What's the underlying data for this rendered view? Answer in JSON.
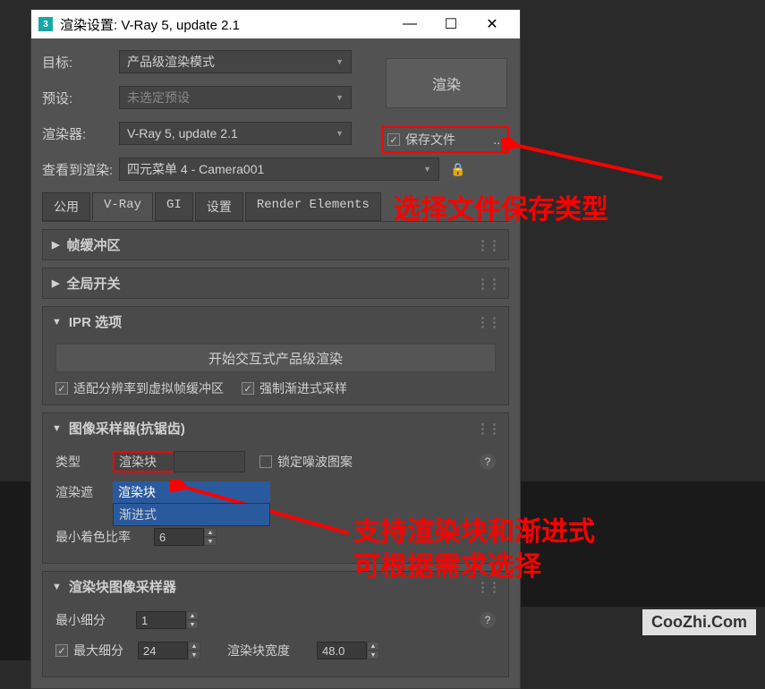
{
  "window": {
    "title": "渲染设置: V-Ray 5, update 2.1"
  },
  "form": {
    "target_label": "目标:",
    "target_value": "产品级渲染模式",
    "preset_label": "预设:",
    "preset_value": "未选定预设",
    "renderer_label": "渲染器:",
    "renderer_value": "V-Ray 5, update 2.1",
    "view_label": "查看到渲染:",
    "view_value": "四元菜单 4 - Camera001"
  },
  "render_button": "渲染",
  "save": {
    "label": "保存文件",
    "dots": "..."
  },
  "tabs": {
    "common": "公用",
    "vray": "V-Ray",
    "gi": "GI",
    "settings": "设置",
    "elements": "Render Elements"
  },
  "rollouts": {
    "fb": "帧缓冲区",
    "global": "全局开关",
    "ipr": {
      "title": "IPR 选项",
      "button": "开始交互式产品级渲染",
      "fit": "适配分辨率到虚拟帧缓冲区",
      "force": "强制渐进式采样"
    },
    "sampler": {
      "title": "图像采样器(抗锯齿)",
      "type_label": "类型",
      "type_value": "渲染块",
      "lock_noise": "锁定噪波图案",
      "rshade_label": "渲染遮",
      "options": {
        "bucket": "渲染块",
        "progressive": "渐进式"
      },
      "shade_label": "最小着色比率",
      "shade_value": "6"
    },
    "bucket": {
      "title": "渲染块图像采样器",
      "min_label": "最小细分",
      "min_value": "1",
      "max_label": "最大细分",
      "max_value": "24",
      "width_label": "渲染块宽度",
      "width_value": "48.0"
    }
  },
  "annotations": {
    "a1": "选择文件保存类型",
    "a2_l1": "支持渲染块和渐进式",
    "a2_l2": "可根据需求选择"
  },
  "watermark": "CooZhi.Com"
}
